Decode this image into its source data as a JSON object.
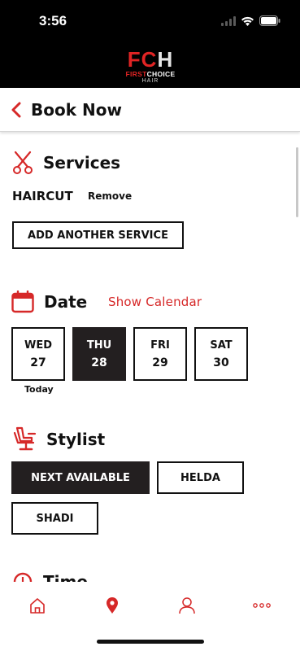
{
  "status_bar": {
    "time": "3:56"
  },
  "brand": {
    "logo_left": "FC",
    "logo_right": "H",
    "line1_left": "FIRST",
    "line1_right": "CHOICE",
    "line2": "HAIR"
  },
  "header": {
    "title": "Book Now"
  },
  "services": {
    "title": "Services",
    "selected_service": "HAIRCUT",
    "remove_label": "Remove",
    "add_button": "ADD ANOTHER SERVICE"
  },
  "date": {
    "title": "Date",
    "show_calendar": "Show Calendar",
    "days": [
      {
        "name": "WED",
        "num": "27",
        "sub": "Today"
      },
      {
        "name": "THU",
        "num": "28"
      },
      {
        "name": "FRI",
        "num": "29"
      },
      {
        "name": "SAT",
        "num": "30"
      }
    ],
    "selected_index": 1
  },
  "stylist": {
    "title": "Stylist",
    "options": [
      "NEXT AVAILABLE",
      "HELDA",
      "SHADI"
    ],
    "selected_index": 0
  },
  "time": {
    "title": "Time"
  },
  "colors": {
    "accent": "#d62828",
    "dark": "#231f20",
    "header_bg": "#000000"
  },
  "bottom_nav": {
    "items": [
      "home-icon",
      "location-pin-icon",
      "user-icon",
      "more-icon"
    ],
    "active_index": 1
  }
}
